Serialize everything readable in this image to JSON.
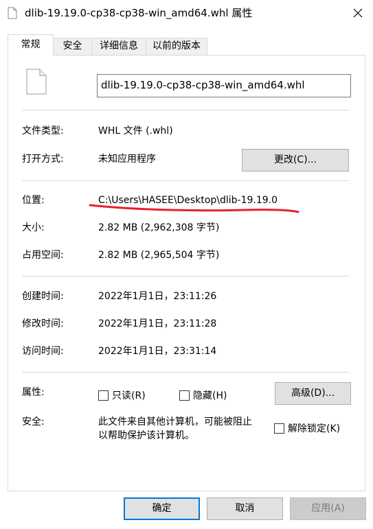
{
  "window": {
    "title": "dlib-19.19.0-cp38-cp38-win_amd64.whl 属性"
  },
  "tabs": [
    {
      "label": "常规"
    },
    {
      "label": "安全"
    },
    {
      "label": "详细信息"
    },
    {
      "label": "以前的版本"
    }
  ],
  "general": {
    "file_name": "dlib-19.19.0-cp38-cp38-win_amd64.whl",
    "file_type": {
      "label": "文件类型:",
      "value": "WHL 文件 (.whl)"
    },
    "opens_with": {
      "label": "打开方式:",
      "value": "未知应用程序",
      "button": "更改(C)..."
    },
    "location": {
      "label": "位置:",
      "value": "C:\\Users\\HASEE\\Desktop\\dlib-19.19.0"
    },
    "size": {
      "label": "大小:",
      "value": "2.82 MB (2,962,308 字节)"
    },
    "size_on_disk": {
      "label": "占用空间:",
      "value": "2.82 MB (2,965,504 字节)"
    },
    "created": {
      "label": "创建时间:",
      "value": "2022年1月1日，23:11:26"
    },
    "modified": {
      "label": "修改时间:",
      "value": "2022年1月1日，23:11:28"
    },
    "accessed": {
      "label": "访问时间:",
      "value": "2022年1月1日，23:31:14"
    },
    "attributes": {
      "label": "属性:",
      "readonly": {
        "label": "只读(R)",
        "checked": false
      },
      "hidden": {
        "label": "隐藏(H)",
        "checked": false
      },
      "advanced_button": "高级(D)..."
    },
    "security": {
      "label": "安全:",
      "text_line1": "此文件来自其他计算机，可能被阻止",
      "text_line2": "以帮助保护该计算机。",
      "unblock": {
        "label": "解除锁定(K)",
        "checked": false
      }
    }
  },
  "footer": {
    "ok": "确定",
    "cancel": "取消",
    "apply": "应用(A)"
  },
  "colors": {
    "annotation_underline": "#e8202a",
    "accent_border": "#0078d7",
    "disabled_text": "#7a7a7a"
  }
}
